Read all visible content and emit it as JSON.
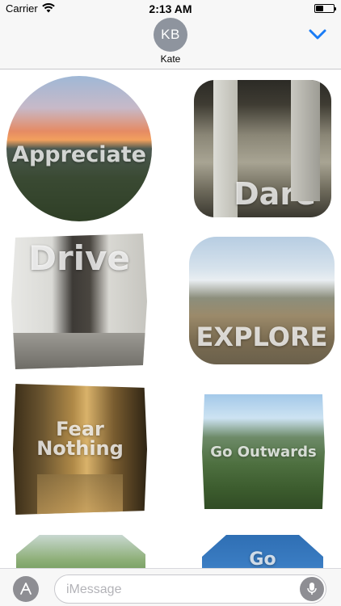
{
  "status_bar": {
    "carrier": "Carrier",
    "wifi_icon": "wifi-icon",
    "time": "2:13 AM",
    "battery_icon": "battery-icon"
  },
  "header": {
    "avatar_initials": "KB",
    "contact_name": "Kate",
    "collapse_icon": "chevron-down-icon",
    "accent_color": "#1a7cf5"
  },
  "stickers": [
    {
      "label": "Appreciate"
    },
    {
      "label": "Dare"
    },
    {
      "label": "Drive"
    },
    {
      "label": "EXPLORE"
    },
    {
      "label": "Fear\nNothing"
    },
    {
      "label": "Go Outwards"
    },
    {
      "label": ""
    },
    {
      "label": "Go"
    }
  ],
  "input_bar": {
    "apps_icon": "app-store-icon",
    "placeholder": "iMessage",
    "mic_icon": "microphone-icon"
  }
}
